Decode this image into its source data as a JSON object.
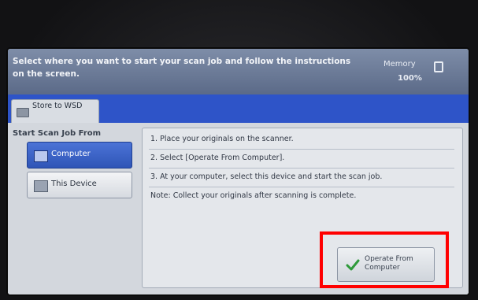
{
  "header": {
    "message": "Select where you want to start your scan job and follow the instructions on the screen.",
    "memory_label": "Memory",
    "memory_value": "100%"
  },
  "tab": {
    "label": "Store to WSD"
  },
  "side": {
    "title": "Start Scan Job From",
    "buttons": [
      {
        "label": "Computer",
        "icon": "computer-icon",
        "selected": true
      },
      {
        "label": "This Device",
        "icon": "device-icon",
        "selected": false
      }
    ]
  },
  "instructions": {
    "step1": "1. Place your originals on the scanner.",
    "step2": "2. Select [Operate From Computer].",
    "step3": "3. At your computer, select this device and start the scan job.",
    "note": "Note: Collect your originals after scanning is complete."
  },
  "action": {
    "operate_label": "Operate From Computer"
  },
  "colors": {
    "tabbar": "#2e54c8",
    "selected": "#2f55b7",
    "highlight": "#ff0000"
  }
}
